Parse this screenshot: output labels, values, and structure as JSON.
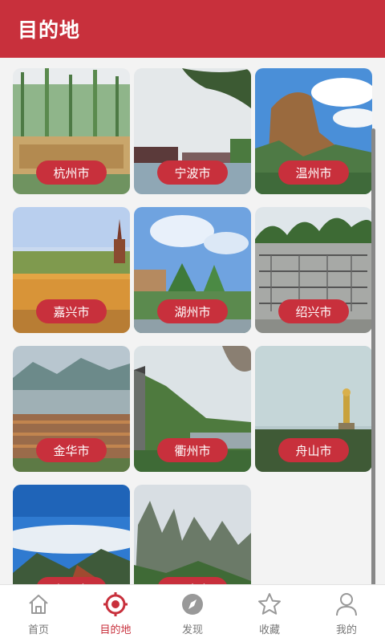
{
  "header": {
    "title": "目的地"
  },
  "cities": [
    {
      "name": "杭州市"
    },
    {
      "name": "宁波市"
    },
    {
      "name": "温州市"
    },
    {
      "name": "嘉兴市"
    },
    {
      "name": "湖州市"
    },
    {
      "name": "绍兴市"
    },
    {
      "name": "金华市"
    },
    {
      "name": "衢州市"
    },
    {
      "name": "舟山市"
    },
    {
      "name": "台州市"
    },
    {
      "name": "丽水市"
    }
  ],
  "tabbar": {
    "items": [
      {
        "label": "首页",
        "icon": "home-icon"
      },
      {
        "label": "目的地",
        "icon": "target-icon",
        "active": true
      },
      {
        "label": "发现",
        "icon": "compass-icon"
      },
      {
        "label": "收藏",
        "icon": "star-icon"
      },
      {
        "label": "我的",
        "icon": "user-icon"
      }
    ]
  },
  "colors": {
    "accent": "#c8303c",
    "inactive": "#777777"
  }
}
